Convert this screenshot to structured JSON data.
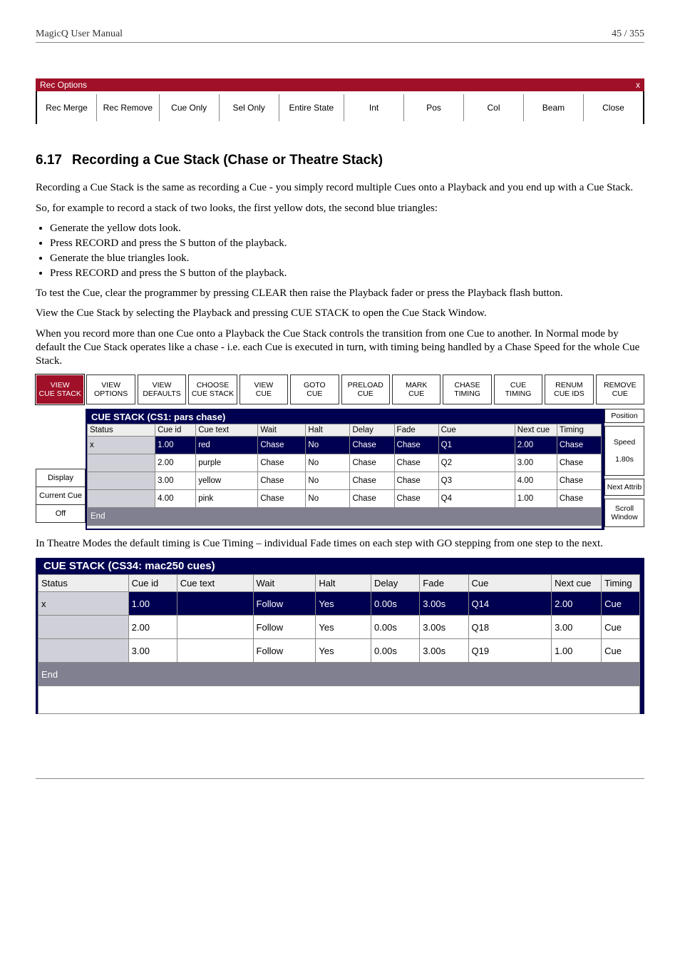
{
  "header": {
    "title": "MagicQ User Manual",
    "page": "45 / 355"
  },
  "rec_options": {
    "title": "Rec Options",
    "close_x": "x",
    "buttons": [
      "Rec Merge",
      "Rec Remove",
      "Cue Only",
      "Sel Only",
      "Entire State",
      "Int",
      "Pos",
      "Col",
      "Beam",
      "Close"
    ]
  },
  "section": {
    "number": "6.17",
    "title": "Recording a Cue Stack (Chase or Theatre Stack)"
  },
  "paragraphs": {
    "p1": "Recording a Cue Stack is the same as recording a Cue - you simply record multiple Cues onto a Playback and you end up with a Cue Stack.",
    "p2": "So, for example to record a stack of two looks, the first yellow dots, the second blue triangles:",
    "p3": "To test the Cue, clear the programmer by pressing CLEAR then raise the Playback fader or press the Playback flash button.",
    "p4": "View the Cue Stack by selecting the Playback and pressing CUE STACK to open the Cue Stack Window.",
    "p5": "When you record more than one Cue onto a Playback the Cue Stack controls the transition from one Cue to another. In Normal mode by default the Cue Stack operates like a chase - i.e. each Cue is executed in turn, with timing being handled by a Chase Speed for the whole Cue Stack.",
    "p6": "In Theatre Modes the default timing is Cue Timing – individual Fade times on each step with GO stepping from one step to the next."
  },
  "bullets": [
    "Generate the yellow dots look.",
    "Press RECORD and press the S button of the playback.",
    "Generate the blue triangles look.",
    "Press RECORD and press the S button of the playback."
  ],
  "softbuttons": [
    "VIEW\nCUE STACK",
    "VIEW\nOPTIONS",
    "VIEW\nDEFAULTS",
    "CHOOSE\nCUE STACK",
    "VIEW\nCUE",
    "GOTO\nCUE",
    "PRELOAD\nCUE",
    "MARK\nCUE",
    "CHASE\nTIMING",
    "CUE\nTIMING",
    "RENUM\nCUE IDS",
    "REMOVE\nCUE"
  ],
  "cs1": {
    "title": "CUE STACK (CS1: pars chase)",
    "headers": [
      "Status",
      "Cue id",
      "Cue text",
      "Wait",
      "Halt",
      "Delay",
      "Fade",
      "Cue",
      "Next cue",
      "Timing"
    ],
    "rows": [
      {
        "status": "x",
        "cueid": "1.00",
        "cuetext": "red",
        "wait": "Chase",
        "halt": "No",
        "delay": "Chase",
        "fade": "Chase",
        "cue": "Q1",
        "next": "2.00",
        "timing": "Chase",
        "sel": true
      },
      {
        "status": "",
        "cueid": "2.00",
        "cuetext": "purple",
        "wait": "Chase",
        "halt": "No",
        "delay": "Chase",
        "fade": "Chase",
        "cue": "Q2",
        "next": "3.00",
        "timing": "Chase",
        "sel": false
      },
      {
        "status": "",
        "cueid": "3.00",
        "cuetext": "yellow",
        "wait": "Chase",
        "halt": "No",
        "delay": "Chase",
        "fade": "Chase",
        "cue": "Q3",
        "next": "4.00",
        "timing": "Chase",
        "sel": false
      },
      {
        "status": "",
        "cueid": "4.00",
        "cuetext": "pink",
        "wait": "Chase",
        "halt": "No",
        "delay": "Chase",
        "fade": "Chase",
        "cue": "Q4",
        "next": "1.00",
        "timing": "Chase",
        "sel": false
      }
    ],
    "end": "End",
    "left_labels": [
      "Display",
      "Current Cue",
      "Off"
    ],
    "right_labels": [
      "Position",
      "Speed",
      "1.80s",
      "Next Attrib",
      "Scroll\nWindow"
    ]
  },
  "cs34": {
    "title": "CUE STACK (CS34: mac250 cues)",
    "headers": [
      "Status",
      "Cue id",
      "Cue text",
      "Wait",
      "Halt",
      "Delay",
      "Fade",
      "Cue",
      "Next cue",
      "Timing"
    ],
    "rows": [
      {
        "status": "x",
        "cueid": "1.00",
        "cuetext": "",
        "wait": "Follow",
        "halt": "Yes",
        "delay": "0.00s",
        "fade": "3.00s",
        "cue": "Q14",
        "next": "2.00",
        "timing": "Cue",
        "sel": true
      },
      {
        "status": "",
        "cueid": "2.00",
        "cuetext": "",
        "wait": "Follow",
        "halt": "Yes",
        "delay": "0.00s",
        "fade": "3.00s",
        "cue": "Q18",
        "next": "3.00",
        "timing": "Cue",
        "sel": false
      },
      {
        "status": "",
        "cueid": "3.00",
        "cuetext": "",
        "wait": "Follow",
        "halt": "Yes",
        "delay": "0.00s",
        "fade": "3.00s",
        "cue": "Q19",
        "next": "1.00",
        "timing": "Cue",
        "sel": false
      }
    ],
    "end": "End"
  }
}
